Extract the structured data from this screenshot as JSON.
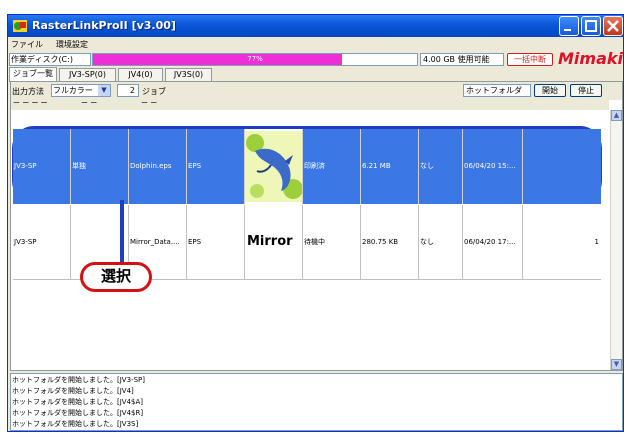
{
  "window": {
    "title": "RasterLinkProII  [v3.00]",
    "colors": {
      "titlebar": "#0a56d8",
      "selection": "#3b78e6",
      "progress": "#ee2fd6",
      "accent_red": "#d02020"
    }
  },
  "menu": {
    "items": [
      "ファイル",
      "環境設定"
    ]
  },
  "disk": {
    "label": "作業ディスク(C:)",
    "usage_percent_text": "77%",
    "usage_fraction": 0.77,
    "free_text": "4.00 GB 使用可能",
    "cancel_all_label": "一括中断",
    "logo_text": "Mimaki"
  },
  "tabs": [
    {
      "label": "ジョブ一覧",
      "active": true
    },
    {
      "label": "JV3-SP(0)",
      "active": false
    },
    {
      "label": "JV4(0)",
      "active": false
    },
    {
      "label": "JV3S(0)",
      "active": false
    }
  ],
  "toolbar": {
    "output_label": "出力方法",
    "output_value": "フルカラー",
    "job_count": "2",
    "job_label": "ジョブ",
    "hotfolder_label": "ホットフォルダ",
    "start_label": "開始",
    "stop_label": "停止"
  },
  "rows": [
    {
      "printer": "JV3-SP",
      "mode": "単独",
      "file": "Dolphin.eps",
      "format": "EPS",
      "thumbnail": "dolphin-thumbnail",
      "status": "印刷済",
      "size": "6.21 MB",
      "option": "なし",
      "date": "06/04/20 15:..."
    },
    {
      "printer": "JV3-SP",
      "mode": "",
      "file": "Mirror_Data....",
      "format": "EPS",
      "thumbnail_text": "Mirror",
      "status": "待機中",
      "size": "280.75 KB",
      "option": "なし",
      "date": "06/04/20 17:...",
      "copies": "1"
    }
  ],
  "callout": {
    "label": "選択"
  },
  "log": {
    "lines": [
      "ホットフォルダを開始しました。[JV3-SP]",
      "ホットフォルダを開始しました。[JV4]",
      "ホットフォルダを開始しました。[JV4$A]",
      "ホットフォルダを開始しました。[JV4$R]",
      "ホットフォルダを開始しました。[JV3S]"
    ]
  }
}
